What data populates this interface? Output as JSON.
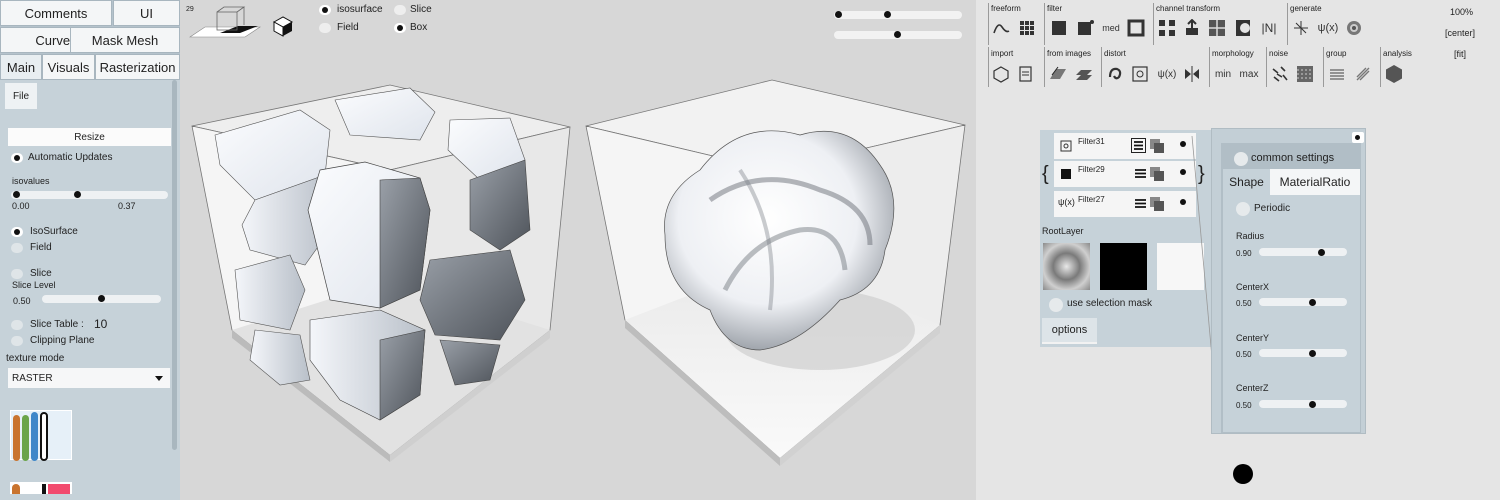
{
  "left_panel": {
    "top_buttons": [
      "Comments",
      "UI",
      "Curves",
      "Mask Mesh"
    ],
    "tabs": [
      "Main",
      "Visuals",
      "Rasterization"
    ],
    "file_label": "File",
    "resize_label": "Resize",
    "automatic_updates": "Automatic Updates",
    "isovalues_label": "isovalues",
    "isovalue_min": "0.00",
    "isovalue_max": "0.37",
    "isosurface": "IsoSurface",
    "field": "Field",
    "slice": "Slice",
    "slice_level_label": "Slice Level",
    "slice_level_value": "0.50",
    "slice_table_label": "Slice Table :",
    "slice_table_value": "10",
    "clipping_plane": "Clipping Plane",
    "texture_mode_label": "texture mode",
    "texture_mode_value": "RASTER"
  },
  "viewport": {
    "view_counter": "29",
    "options": {
      "isosurface": "isosurface",
      "slice": "Slice",
      "field": "Field",
      "box": "Box"
    },
    "slider1_value": 0.42,
    "slider2_value": 0.5
  },
  "toolbar": {
    "row1": [
      {
        "label": "freeform",
        "icons": [
          "curve-icon",
          "grid-icon"
        ]
      },
      {
        "label": "filter",
        "icons": [
          "square-icon",
          "dots-square-icon",
          "median-icon",
          "frame-icon"
        ]
      },
      {
        "label": "channel transform",
        "icons": [
          "split-icon",
          "upload-icon",
          "pattern-icon",
          "contrast-icon",
          "abs-icon"
        ]
      },
      {
        "label": "generate",
        "icons": [
          "sparkle-icon",
          "psi-icon",
          "spiral-icon"
        ]
      }
    ],
    "row2": [
      {
        "label": "import",
        "icons": [
          "import-mesh-icon",
          "import-doc-icon"
        ]
      },
      {
        "label": "from images",
        "icons": [
          "images-icon",
          "stack-icon"
        ]
      },
      {
        "label": "distort",
        "icons": [
          "swirl-icon",
          "warp-icon",
          "psi-func-icon",
          "mirror-icon"
        ]
      },
      {
        "label": "morphology",
        "icons": [
          "min-icon",
          "max-icon"
        ]
      },
      {
        "label": "noise",
        "icons": [
          "noise-icon",
          "noise2-icon"
        ]
      },
      {
        "label": "group",
        "icons": [
          "group-icon",
          "ungroup-icon"
        ]
      },
      {
        "label": "analysis",
        "icons": [
          "hexagon-icon"
        ]
      }
    ],
    "zoom_text": "100%",
    "center_text": "[center]",
    "fit_text": "[fit]",
    "min_text": "min",
    "max_text": "max",
    "med_text": "med",
    "abs_text": "|N|",
    "psi_text": "ψ(x)"
  },
  "layers": {
    "filters": [
      "Filter31",
      "Filter29",
      "Filter27"
    ],
    "root_layer_label": "RootLayer",
    "use_selection_mask": "use selection mask",
    "options_button": "options"
  },
  "shape_panel": {
    "common_settings": "common settings",
    "tabs": [
      "Shape",
      "MaterialRatio"
    ],
    "periodic": "Periodic",
    "params": [
      {
        "label": "Radius",
        "value": "0.90",
        "fraction": 0.72
      },
      {
        "label": "CenterX",
        "value": "0.50",
        "fraction": 0.5
      },
      {
        "label": "CenterY",
        "value": "0.50",
        "fraction": 0.5
      },
      {
        "label": "CenterZ",
        "value": "0.50",
        "fraction": 0.5
      }
    ]
  }
}
